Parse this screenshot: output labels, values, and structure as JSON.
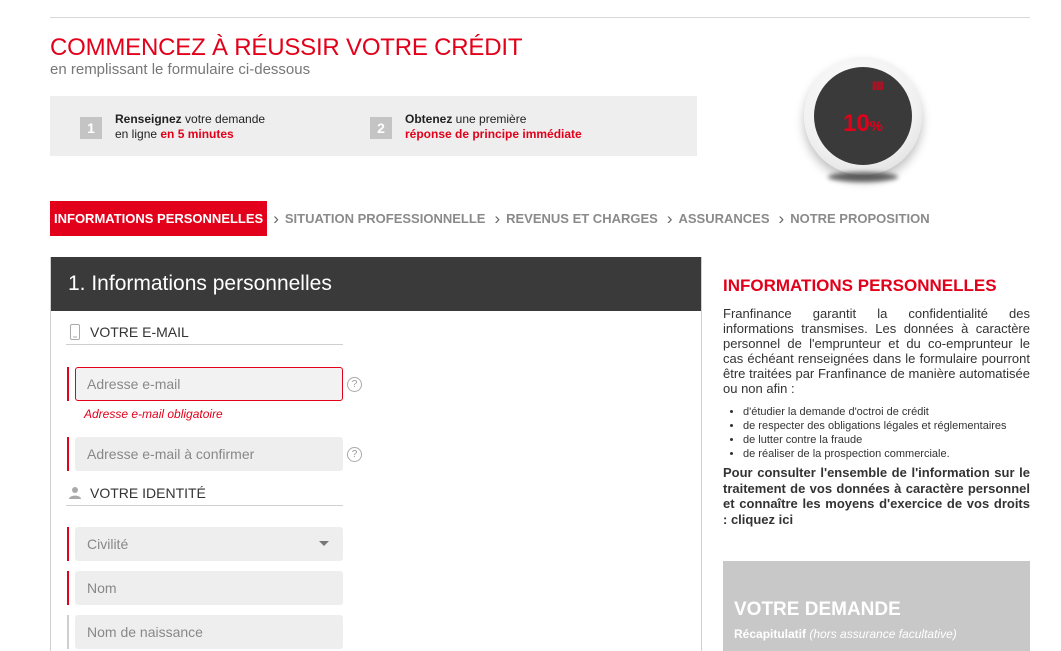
{
  "header": {
    "title": "COMMENCEZ À RÉUSSIR VOTRE CRÉDIT",
    "subtitle": "en remplissant le formulaire ci-dessous"
  },
  "steps": [
    {
      "number": "1",
      "bold": "Renseignez",
      "text": " votre demande",
      "line2_prefix": "en ligne ",
      "line2_highlight": "en 5 minutes"
    },
    {
      "number": "2",
      "bold": "Obtenez",
      "text": " une première",
      "line2_prefix": "",
      "line2_highlight": "réponse de principe immédiate"
    }
  ],
  "progress": {
    "value": 10,
    "value_label": "10",
    "unit": "%",
    "ticks": "||||||||"
  },
  "breadcrumb": [
    {
      "label": "INFORMATIONS PERSONNELLES",
      "active": true
    },
    {
      "label": "SITUATION PROFESSIONNELLE",
      "active": false
    },
    {
      "label": "REVENUS ET CHARGES",
      "active": false
    },
    {
      "label": "ASSURANCES",
      "active": false
    },
    {
      "label": "NOTRE PROPOSITION",
      "active": false
    }
  ],
  "form": {
    "title": "1. Informations personnelles",
    "email_section": "VOTRE E-MAIL",
    "email_placeholder": "Adresse e-mail",
    "email_error": "Adresse e-mail obligatoire",
    "email_confirm_placeholder": "Adresse e-mail à confirmer",
    "identity_section": "VOTRE IDENTITÉ",
    "civility_placeholder": "Civilité",
    "name_placeholder": "Nom",
    "birth_name_placeholder": "Nom de naissance",
    "help_glyph": "?"
  },
  "info": {
    "title": "INFORMATIONS PERSONNELLES",
    "paragraph": "Franfinance garantit la confidentialité des informations transmises. Les données à caractère personnel de l'emprunteur et du co-emprunteur le cas échéant renseignées dans le formulaire pourront être traitées par Franfinance de manière automatisée ou non afin :",
    "bullets": [
      "d'étudier la demande d'octroi de crédit",
      "de respecter des obligations légales et réglementaires",
      "de lutter contre la fraude",
      "de réaliser de la prospection commerciale."
    ],
    "bold_text": "Pour consulter l'ensemble de l'information sur le traitement de vos données à caractère personnel et connaître les moyens d'exercice de vos droits : cliquez ici"
  },
  "demand": {
    "title": "VOTRE DEMANDE",
    "sub_bold": "Récapitulatif",
    "sub_italic": " (hors assurance facultative)"
  },
  "colors": {
    "accent": "#e2001a",
    "dark_header": "#3a3a3a",
    "field_bg": "#eeeeee",
    "demand_bg": "#c8c8c8"
  }
}
